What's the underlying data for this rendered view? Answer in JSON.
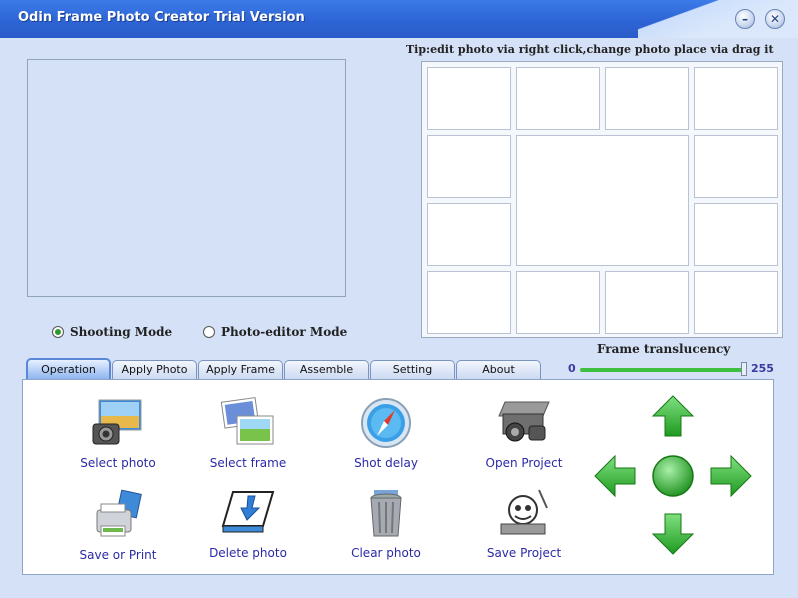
{
  "window": {
    "title": "Odin Frame Photo Creator Trial Version"
  },
  "titlebar": {
    "minimize_icon": "minimize-icon",
    "close_icon": "close-icon"
  },
  "tip": "Tip:edit photo via right click,change photo place via drag it",
  "modes": {
    "shooting": "Shooting Mode",
    "editor": "Photo-editor Mode",
    "selected": "shooting"
  },
  "translucency": {
    "title": "Frame translucency",
    "min": "0",
    "max": "255",
    "value": 255,
    "range": [
      0,
      255
    ]
  },
  "tabs": [
    {
      "label": "Operation",
      "active": true
    },
    {
      "label": "Apply Photo",
      "active": false
    },
    {
      "label": "Apply Frame",
      "active": false
    },
    {
      "label": "Assemble photo",
      "active": false
    },
    {
      "label": "Setting",
      "active": false
    },
    {
      "label": "About",
      "active": false
    }
  ],
  "tools": [
    {
      "label": "Select photo",
      "icon": "camera-photo-icon"
    },
    {
      "label": "Select frame",
      "icon": "frame-pictures-icon"
    },
    {
      "label": "Shot delay",
      "icon": "compass-timer-icon"
    },
    {
      "label": "Open Project",
      "icon": "open-project-icon"
    },
    {
      "label": "Save or Print",
      "icon": "printer-icon"
    },
    {
      "label": "Delete photo",
      "icon": "delete-photo-icon"
    },
    {
      "label": "Clear photo",
      "icon": "trash-bin-icon"
    },
    {
      "label": "Save Project",
      "icon": "save-project-icon"
    }
  ],
  "nav": {
    "up": "arrow-up-icon",
    "down": "arrow-down-icon",
    "left": "arrow-left-icon",
    "right": "arrow-right-icon",
    "center": "center-button-icon"
  },
  "colors": {
    "titlebar": "#2d63d4",
    "background": "#d4e1f6",
    "arrow_green": "#3fbf3f",
    "label_blue": "#2a2aa8"
  }
}
